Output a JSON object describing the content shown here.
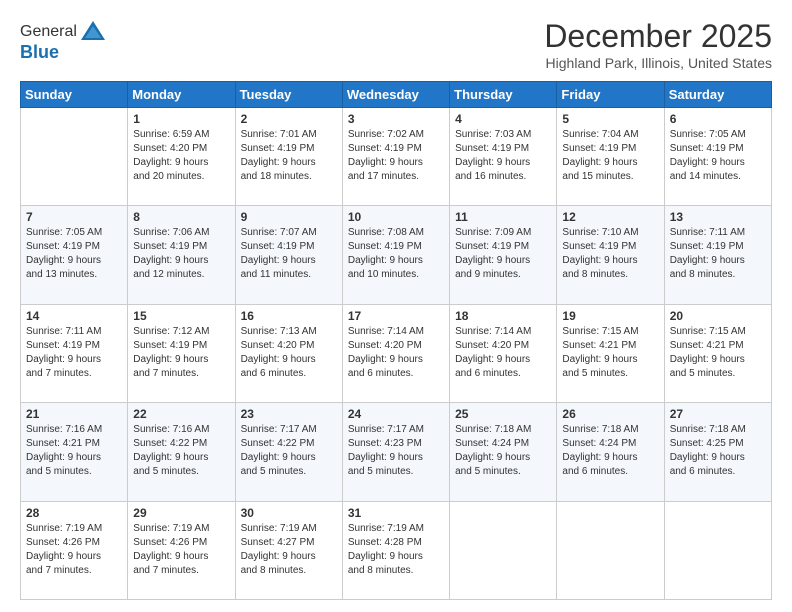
{
  "header": {
    "logo_line1": "General",
    "logo_line2": "Blue",
    "title": "December 2025",
    "subtitle": "Highland Park, Illinois, United States"
  },
  "days_of_week": [
    "Sunday",
    "Monday",
    "Tuesday",
    "Wednesday",
    "Thursday",
    "Friday",
    "Saturday"
  ],
  "weeks": [
    [
      {
        "num": "",
        "info": ""
      },
      {
        "num": "1",
        "info": "Sunrise: 6:59 AM\nSunset: 4:20 PM\nDaylight: 9 hours\nand 20 minutes."
      },
      {
        "num": "2",
        "info": "Sunrise: 7:01 AM\nSunset: 4:19 PM\nDaylight: 9 hours\nand 18 minutes."
      },
      {
        "num": "3",
        "info": "Sunrise: 7:02 AM\nSunset: 4:19 PM\nDaylight: 9 hours\nand 17 minutes."
      },
      {
        "num": "4",
        "info": "Sunrise: 7:03 AM\nSunset: 4:19 PM\nDaylight: 9 hours\nand 16 minutes."
      },
      {
        "num": "5",
        "info": "Sunrise: 7:04 AM\nSunset: 4:19 PM\nDaylight: 9 hours\nand 15 minutes."
      },
      {
        "num": "6",
        "info": "Sunrise: 7:05 AM\nSunset: 4:19 PM\nDaylight: 9 hours\nand 14 minutes."
      }
    ],
    [
      {
        "num": "7",
        "info": "Sunrise: 7:05 AM\nSunset: 4:19 PM\nDaylight: 9 hours\nand 13 minutes."
      },
      {
        "num": "8",
        "info": "Sunrise: 7:06 AM\nSunset: 4:19 PM\nDaylight: 9 hours\nand 12 minutes."
      },
      {
        "num": "9",
        "info": "Sunrise: 7:07 AM\nSunset: 4:19 PM\nDaylight: 9 hours\nand 11 minutes."
      },
      {
        "num": "10",
        "info": "Sunrise: 7:08 AM\nSunset: 4:19 PM\nDaylight: 9 hours\nand 10 minutes."
      },
      {
        "num": "11",
        "info": "Sunrise: 7:09 AM\nSunset: 4:19 PM\nDaylight: 9 hours\nand 9 minutes."
      },
      {
        "num": "12",
        "info": "Sunrise: 7:10 AM\nSunset: 4:19 PM\nDaylight: 9 hours\nand 8 minutes."
      },
      {
        "num": "13",
        "info": "Sunrise: 7:11 AM\nSunset: 4:19 PM\nDaylight: 9 hours\nand 8 minutes."
      }
    ],
    [
      {
        "num": "14",
        "info": "Sunrise: 7:11 AM\nSunset: 4:19 PM\nDaylight: 9 hours\nand 7 minutes."
      },
      {
        "num": "15",
        "info": "Sunrise: 7:12 AM\nSunset: 4:19 PM\nDaylight: 9 hours\nand 7 minutes."
      },
      {
        "num": "16",
        "info": "Sunrise: 7:13 AM\nSunset: 4:20 PM\nDaylight: 9 hours\nand 6 minutes."
      },
      {
        "num": "17",
        "info": "Sunrise: 7:14 AM\nSunset: 4:20 PM\nDaylight: 9 hours\nand 6 minutes."
      },
      {
        "num": "18",
        "info": "Sunrise: 7:14 AM\nSunset: 4:20 PM\nDaylight: 9 hours\nand 6 minutes."
      },
      {
        "num": "19",
        "info": "Sunrise: 7:15 AM\nSunset: 4:21 PM\nDaylight: 9 hours\nand 5 minutes."
      },
      {
        "num": "20",
        "info": "Sunrise: 7:15 AM\nSunset: 4:21 PM\nDaylight: 9 hours\nand 5 minutes."
      }
    ],
    [
      {
        "num": "21",
        "info": "Sunrise: 7:16 AM\nSunset: 4:21 PM\nDaylight: 9 hours\nand 5 minutes."
      },
      {
        "num": "22",
        "info": "Sunrise: 7:16 AM\nSunset: 4:22 PM\nDaylight: 9 hours\nand 5 minutes."
      },
      {
        "num": "23",
        "info": "Sunrise: 7:17 AM\nSunset: 4:22 PM\nDaylight: 9 hours\nand 5 minutes."
      },
      {
        "num": "24",
        "info": "Sunrise: 7:17 AM\nSunset: 4:23 PM\nDaylight: 9 hours\nand 5 minutes."
      },
      {
        "num": "25",
        "info": "Sunrise: 7:18 AM\nSunset: 4:24 PM\nDaylight: 9 hours\nand 5 minutes."
      },
      {
        "num": "26",
        "info": "Sunrise: 7:18 AM\nSunset: 4:24 PM\nDaylight: 9 hours\nand 6 minutes."
      },
      {
        "num": "27",
        "info": "Sunrise: 7:18 AM\nSunset: 4:25 PM\nDaylight: 9 hours\nand 6 minutes."
      }
    ],
    [
      {
        "num": "28",
        "info": "Sunrise: 7:19 AM\nSunset: 4:26 PM\nDaylight: 9 hours\nand 7 minutes."
      },
      {
        "num": "29",
        "info": "Sunrise: 7:19 AM\nSunset: 4:26 PM\nDaylight: 9 hours\nand 7 minutes."
      },
      {
        "num": "30",
        "info": "Sunrise: 7:19 AM\nSunset: 4:27 PM\nDaylight: 9 hours\nand 8 minutes."
      },
      {
        "num": "31",
        "info": "Sunrise: 7:19 AM\nSunset: 4:28 PM\nDaylight: 9 hours\nand 8 minutes."
      },
      {
        "num": "",
        "info": ""
      },
      {
        "num": "",
        "info": ""
      },
      {
        "num": "",
        "info": ""
      }
    ]
  ]
}
